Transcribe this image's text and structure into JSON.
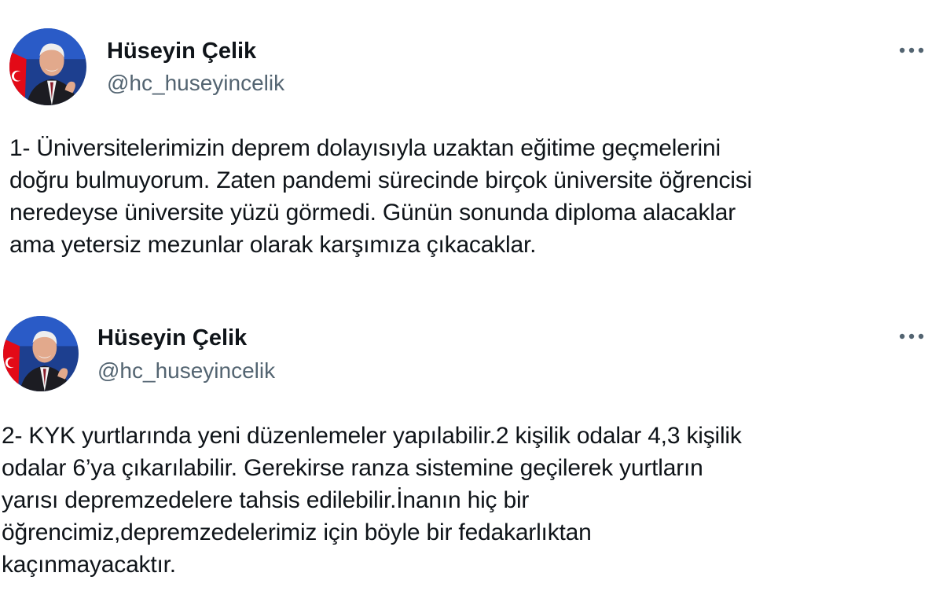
{
  "tweets": [
    {
      "author": {
        "name": "Hüseyin Çelik",
        "handle": "@hc_huseyincelik",
        "avatar_icon": "profile-photo"
      },
      "more_icon": "more-horizontal-icon",
      "text": "1- Üniversitelerimizin deprem dolayısıyla uzaktan eğitime geçmelerini\ndoğru bulmuyorum. Zaten pandemi sürecinde birçok üniversite öğrencisi\nneredeyse üniversite yüzü görmedi. Günün sonunda diploma alacaklar\nama yetersiz mezunlar olarak karşımıza çıkacaklar."
    },
    {
      "author": {
        "name": "Hüseyin Çelik",
        "handle": "@hc_huseyincelik",
        "avatar_icon": "profile-photo"
      },
      "more_icon": "more-horizontal-icon",
      "text": "2- KYK yurtlarında yeni düzenlemeler yapılabilir.2 kişilik odalar 4,3 kişilik\nodalar 6’ya çıkarılabilir. Gerekirse ranza sistemine geçilerek yurtların\nyarısı depremzedelere tahsis edilebilir.İnanın hiç bir\nöğrencimiz,depremzedelerimiz için böyle bir fedakarlıktan\nkaçınmayacaktır."
    }
  ],
  "colors": {
    "text_primary": "#0f1419",
    "text_secondary": "#536471",
    "background": "#ffffff",
    "avatar_bg": "#1d3f8f",
    "flag_red": "#e30a17"
  }
}
